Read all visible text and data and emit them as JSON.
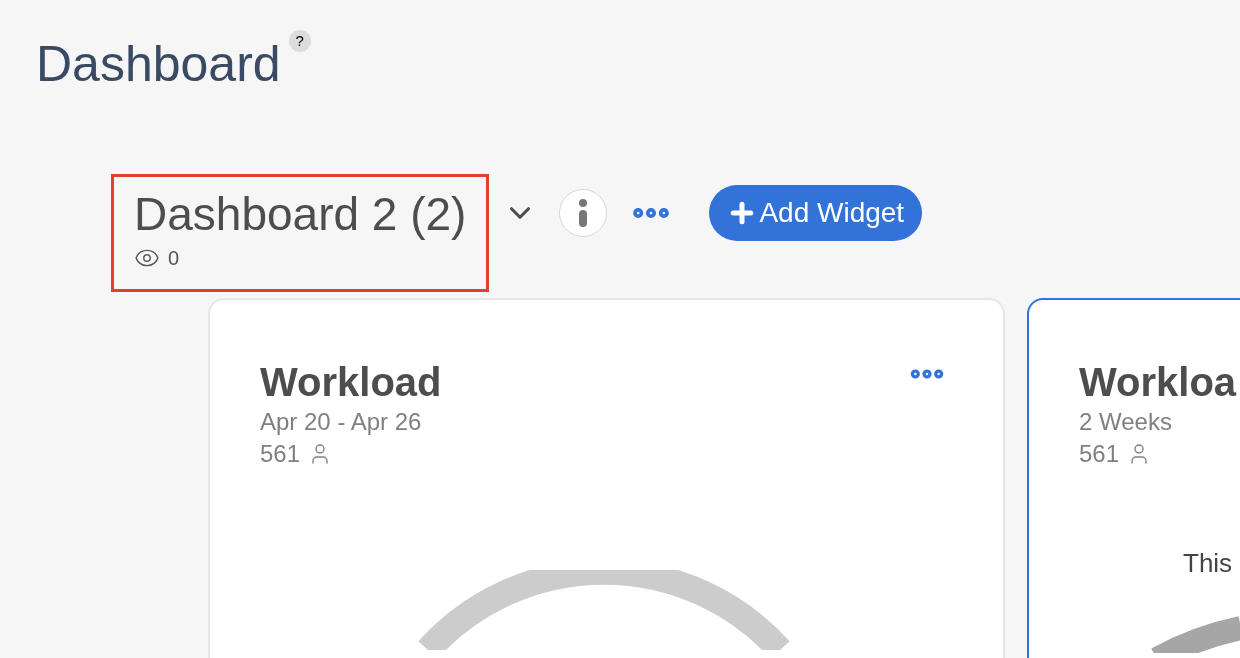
{
  "page": {
    "title": "Dashboard",
    "help": "?"
  },
  "dashboard": {
    "title": "Dashboard 2 (2)",
    "views": "0",
    "highlighted": true,
    "add_button": "Add Widget"
  },
  "widgets": [
    {
      "title": "Workload",
      "period": "Apr 20 - Apr 26",
      "count": "561",
      "selected": false,
      "menu": true,
      "color": "#cccccc"
    },
    {
      "title": "Workloa",
      "period": "2 Weeks",
      "count": "561",
      "selected": true,
      "menu": false,
      "caption": "This",
      "color": "#a6a6a6"
    }
  ]
}
